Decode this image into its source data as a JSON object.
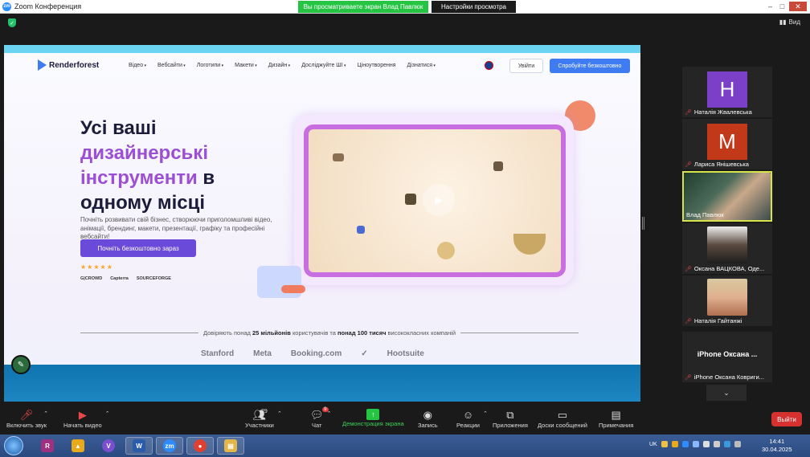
{
  "window": {
    "title": "Zoom Конференция",
    "logo_text": "zm"
  },
  "share_banner": {
    "text": "Вы просматриваете экран Влад Павлюк",
    "view_settings": "Настройки просмотра"
  },
  "topbar": {
    "view_label": "Вид"
  },
  "website": {
    "logo": "Renderforest",
    "nav": [
      "Відео",
      "Вебсайти",
      "Логотипи",
      "Макети",
      "Дизайн",
      "Досліджуйте ШІ",
      "Ціноутворення",
      "Дізнатися"
    ],
    "login": "Увійти",
    "try_free": "Спробуйте безкоштовно",
    "hero_line1": "Усі ваші",
    "hero_line2": "дизайнерські",
    "hero_line3a": "інструменти",
    "hero_line3b": " в",
    "hero_line4": "одному місці",
    "hero_sub": "Почніть розвивати свій бізнес, створюючи приголомшливі відео, анімації, брендинг, макети, презентації, графіку та професійні вебсайти!",
    "cta": "Почніть безкоштовно зараз",
    "stars": "★★★★★",
    "review_sites": [
      "G|CROWD",
      "Capterra",
      "SOURCEFORGE"
    ],
    "trust_pre": "Довіряють понад ",
    "trust_bold1": "25 мільйонів",
    "trust_mid": " користувачів та ",
    "trust_bold2": "понад 100 тисяч",
    "trust_post": " висококласних компаній",
    "brands": [
      "Stanford",
      "Meta",
      "Booking.com",
      "Nike",
      "Hootsuite"
    ]
  },
  "participants": [
    {
      "name": "Наталія Жвалевська",
      "initial": "H",
      "color": "#7b3fc8",
      "muted": true
    },
    {
      "name": "Лариса Янішевська",
      "initial": "M",
      "color": "#c2391a",
      "muted": true
    },
    {
      "name": "Влад Павлюк",
      "active": true
    },
    {
      "name": "Оксана  ВАЦКОВА, Оде...",
      "muted": true
    },
    {
      "name": "Наталія Гайтанжі",
      "muted": true
    },
    {
      "name": "iPhone Оксана Ковриги...",
      "big_name": "iPhone  Оксана ...",
      "muted": true
    }
  ],
  "toolbar": {
    "audio": "Включить звук",
    "video": "Начать видео",
    "participants": "Участники",
    "participants_count": "29",
    "chat": "Чат",
    "chat_badge": "9",
    "share": "Демонстрация экрана",
    "record": "Запись",
    "reactions": "Реакции",
    "apps": "Приложения",
    "whiteboards": "Доски сообщений",
    "notes": "Примечания",
    "leave": "Выйти"
  },
  "taskbar": {
    "apps": [
      {
        "name": "WinRAR",
        "glyph": "R",
        "color": "#a03080"
      },
      {
        "name": "Archicad",
        "glyph": "▲",
        "color": "#e8a91a"
      },
      {
        "name": "Viber",
        "glyph": "V",
        "color": "#7b4fd0"
      },
      {
        "name": "Word",
        "glyph": "W",
        "color": "#2a5caa"
      },
      {
        "name": "Zoom",
        "glyph": "zm",
        "color": "#2d8cff"
      },
      {
        "name": "Chrome",
        "glyph": "●",
        "color": "#e04030"
      },
      {
        "name": "Explorer",
        "glyph": "▤",
        "color": "#e3b64a"
      }
    ],
    "lang": "UK",
    "time": "14:41",
    "date": "30.04.2025"
  }
}
